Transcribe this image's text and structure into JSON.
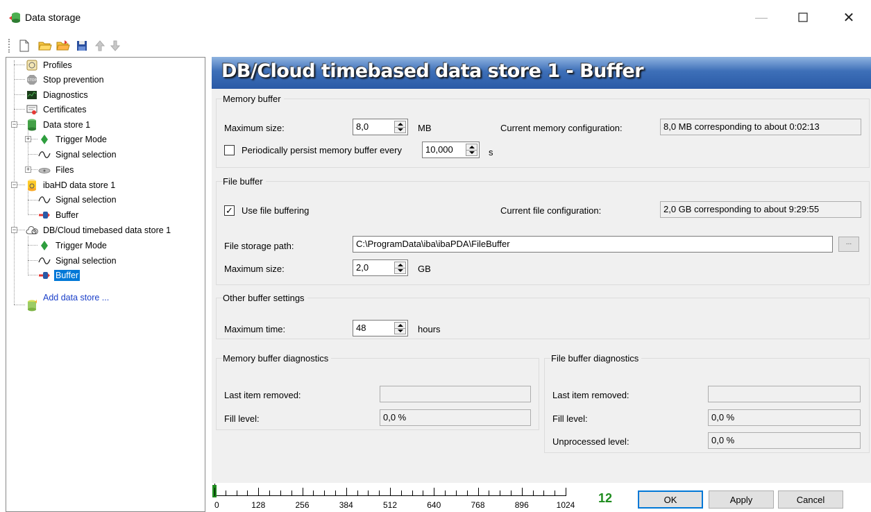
{
  "window": {
    "title": "Data storage"
  },
  "tree": {
    "items": [
      {
        "label": "Profiles",
        "icon": "profiles-icon"
      },
      {
        "label": "Stop prevention",
        "icon": "stop-icon"
      },
      {
        "label": "Diagnostics",
        "icon": "diagnostics-icon"
      },
      {
        "label": "Certificates",
        "icon": "certificates-icon"
      },
      {
        "label": "Data store 1",
        "icon": "data-store-icon"
      },
      {
        "label": "Trigger Mode",
        "icon": "trigger-icon"
      },
      {
        "label": "Signal selection",
        "icon": "signal-icon"
      },
      {
        "label": "Files",
        "icon": "files-icon"
      },
      {
        "label": "ibaHD data store 1",
        "icon": "hd-store-icon"
      },
      {
        "label": "Signal selection",
        "icon": "signal-icon"
      },
      {
        "label": "Buffer",
        "icon": "buffer-icon"
      },
      {
        "label": "DB/Cloud timebased data store 1",
        "icon": "cloud-store-icon"
      },
      {
        "label": "Trigger Mode",
        "icon": "trigger-icon"
      },
      {
        "label": "Signal selection",
        "icon": "signal-icon"
      },
      {
        "label": "Buffer",
        "icon": "buffer-icon",
        "selected": true
      },
      {
        "label": "Add data store ...",
        "icon": "add-store-icon"
      }
    ]
  },
  "page": {
    "heading": "DB/Cloud timebased data store 1 - Buffer",
    "memory_buffer": {
      "title": "Memory buffer",
      "max_size_label": "Maximum size:",
      "max_size_value": "8,0",
      "max_size_unit": "MB",
      "current_config_label": "Current memory configuration:",
      "current_config_value": "8,0 MB corresponding to about 0:02:13",
      "persist_label": "Periodically persist memory buffer every",
      "persist_checked": false,
      "persist_value": "10,000",
      "persist_unit": "s"
    },
    "file_buffer": {
      "title": "File buffer",
      "use_label": "Use file buffering",
      "use_checked": true,
      "current_config_label": "Current file configuration:",
      "current_config_value": "2,0 GB corresponding to about 9:29:55",
      "path_label": "File storage path:",
      "path_value": "C:\\ProgramData\\iba\\ibaPDA\\FileBuffer",
      "browse_label": "...",
      "max_size_label": "Maximum size:",
      "max_size_value": "2,0",
      "max_size_unit": "GB"
    },
    "other": {
      "title": "Other buffer settings",
      "max_time_label": "Maximum time:",
      "max_time_value": "48",
      "max_time_unit": "hours"
    },
    "memory_diag": {
      "title": "Memory buffer diagnostics",
      "last_removed_label": "Last item removed:",
      "last_removed_value": "",
      "fill_label": "Fill level:",
      "fill_value": "0,0 %"
    },
    "file_diag": {
      "title": "File buffer diagnostics",
      "last_removed_label": "Last item removed:",
      "last_removed_value": "",
      "fill_label": "Fill level:",
      "fill_value": "0,0 %",
      "unprocessed_label": "Unprocessed level:",
      "unprocessed_value": "0,0 %"
    }
  },
  "footer": {
    "ruler_labels": [
      "0",
      "128",
      "256",
      "384",
      "512",
      "640",
      "768",
      "896",
      "1024"
    ],
    "ruler_fill_fraction": 0.012,
    "counter": "12",
    "ok_label": "OK",
    "apply_label": "Apply",
    "cancel_label": "Cancel"
  },
  "colors": {
    "selection": "#0078d7",
    "header_gradient_top": "#8fb3e0",
    "header_gradient_bottom": "#2a5aa6",
    "counter_green": "#1e8c1e"
  }
}
